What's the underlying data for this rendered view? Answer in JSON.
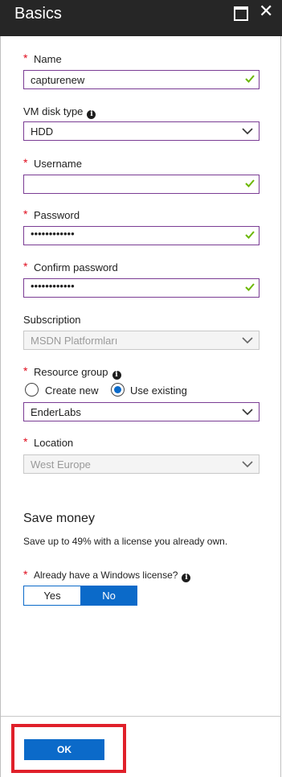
{
  "window": {
    "title": "Basics"
  },
  "form": {
    "name": {
      "label": "Name",
      "value": "capturenew"
    },
    "vm_disk_type": {
      "label": "VM disk type",
      "value": "HDD"
    },
    "username": {
      "label": "Username",
      "value": ""
    },
    "password": {
      "label": "Password",
      "value": "••••••••••••"
    },
    "confirm_password": {
      "label": "Confirm password",
      "value": "••••••••••••"
    },
    "subscription": {
      "label": "Subscription",
      "value": "MSDN Platformları"
    },
    "resource_group": {
      "label": "Resource group",
      "options": {
        "create_new": "Create new",
        "use_existing": "Use existing"
      },
      "selected_option": "Use existing",
      "value": "EnderLabs"
    },
    "location": {
      "label": "Location",
      "value": "West Europe"
    },
    "required_marker": "*"
  },
  "save_money": {
    "heading": "Save money",
    "description": "Save up to 49% with a license you already own.",
    "license_question": "Already have a Windows license?",
    "yes_label": "Yes",
    "no_label": "No",
    "selected": "No"
  },
  "footer": {
    "ok_label": "OK"
  },
  "colors": {
    "accent": "#0b6ac9",
    "field_border": "#7a3c94",
    "valid_check": "#6bb700",
    "required": "#e00b1c",
    "highlight": "#e0202a",
    "titlebar": "#262626"
  }
}
